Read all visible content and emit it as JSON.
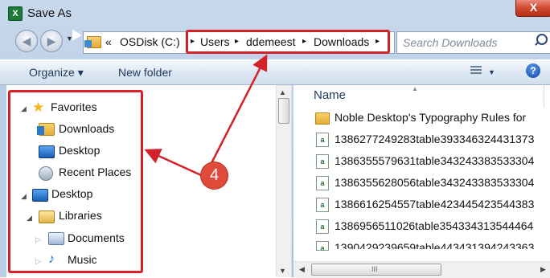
{
  "window": {
    "title": "Save As",
    "close_label": "X"
  },
  "nav": {
    "back_label": "◀",
    "forward_label": "▶",
    "recent_label": "▼"
  },
  "address": {
    "prefix": "«",
    "segments": [
      "OSDisk (C:)",
      "Users",
      "ddemeest",
      "Downloads"
    ],
    "separator": "▸"
  },
  "search": {
    "placeholder": "Search Downloads"
  },
  "toolbar": {
    "organize_label": "Organize ▾",
    "new_folder_label": "New folder",
    "help_label": "?"
  },
  "navigation_tree": {
    "favorites": "Favorites",
    "downloads": "Downloads",
    "desktop_fav": "Desktop",
    "recent_places": "Recent Places",
    "desktop": "Desktop",
    "libraries": "Libraries",
    "documents": "Documents",
    "music": "Music"
  },
  "file_list": {
    "column_name": "Name",
    "rows": [
      "Noble Desktop's Typography Rules for",
      "1386277249283table393346324431373",
      "1386355579631table343243383533304",
      "1386355628056table343243383533304",
      "1386616254557table423445423544383",
      "1386956511026table354334313544464",
      "1390429239659table443431394243363"
    ]
  },
  "callout": {
    "number": "4"
  },
  "colors": {
    "highlight": "#d3222a",
    "callout": "#e04a3b",
    "toolbar_text": "#1e395b"
  },
  "icons": [
    "excel-icon",
    "back-icon",
    "forward-icon",
    "folder-icon",
    "search-icon",
    "view-icon",
    "help-icon",
    "star-icon",
    "desktop-icon",
    "recent-places-icon",
    "libraries-icon",
    "documents-icon",
    "music-icon",
    "csv-icon"
  ]
}
